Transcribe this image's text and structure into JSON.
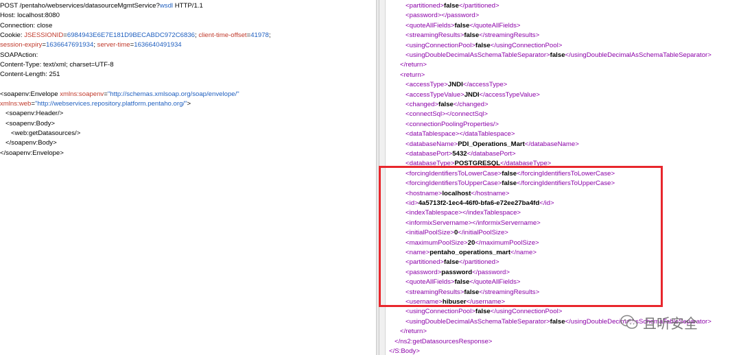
{
  "left": {
    "request_line": {
      "method_path": "POST /pentaho/webservices/datasourceMgmtService?",
      "param": "wsdl",
      "proto": " HTTP/1.1"
    },
    "headers": [
      {
        "name": "Host",
        "value": "localhost:8080"
      },
      {
        "name": "Connection",
        "value": "close"
      },
      {
        "name": "Cookie",
        "value": ""
      },
      {
        "name": "SOAPAction",
        "value": ""
      },
      {
        "name": "Content-Type",
        "value": "text/xml; charset=UTF-8"
      },
      {
        "name": "Content-Length",
        "value": "251"
      }
    ],
    "cookie_parts": [
      {
        "k": "JSESSIONID",
        "v": "6984943E6E7E181D9BECABDC972C6836"
      },
      {
        "k": "client-time-offset",
        "v": "41978"
      },
      {
        "k": "session-expiry",
        "v": "1636647691934"
      },
      {
        "k": "server-time",
        "v": "1636640491934"
      }
    ],
    "envelope_open": "<soapenv:Envelope",
    "ns_attr": "xmlns:soapenv",
    "ns_value": "\"http://schemas.xmlsoap.org/soap/envelope/\"",
    "ns2_attr": "xmlns:web",
    "ns2_value": "\"http://webservices.repository.platform.pentaho.org/\"",
    "header_tag": "<soapenv:Header/>",
    "body_open": "<soapenv:Body>",
    "web_tag": "<web:getDatasources/>",
    "body_close": "</soapenv:Body>",
    "envelope_close": "</soapenv:Envelope>"
  },
  "right": {
    "lines": [
      {
        "indent": 3,
        "tag": "partitioned",
        "value": "false"
      },
      {
        "indent": 3,
        "tag": "password",
        "value": ""
      },
      {
        "indent": 3,
        "tag": "quoteAllFields",
        "value": "false"
      },
      {
        "indent": 3,
        "tag": "streamingResults",
        "value": "false"
      },
      {
        "indent": 3,
        "tag": "usingConnectionPool",
        "value": "false"
      },
      {
        "indent": 3,
        "tag": "usingDoubleDecimalAsSchemaTableSeparator",
        "value": "false"
      },
      {
        "indent": 2,
        "raw": "</return>"
      },
      {
        "indent": 2,
        "raw": "<return>"
      },
      {
        "indent": 3,
        "tag": "accessType",
        "value": "JNDI"
      },
      {
        "indent": 3,
        "tag": "accessTypeValue",
        "value": "JNDI"
      },
      {
        "indent": 3,
        "tag": "changed",
        "value": "false"
      },
      {
        "indent": 3,
        "tag": "connectSql",
        "value": ""
      },
      {
        "indent": 3,
        "raw": "<connectionPoolingProperties/>"
      },
      {
        "indent": 3,
        "tag": "dataTablespace",
        "value": ""
      },
      {
        "indent": 3,
        "tag": "databaseName",
        "value": "PDI_Operations_Mart"
      },
      {
        "indent": 3,
        "tag": "databasePort",
        "value": "5432"
      },
      {
        "indent": 3,
        "tag": "databaseType",
        "value": "POSTGRESQL"
      },
      {
        "indent": 3,
        "tag": "forcingIdentifiersToLowerCase",
        "value": "false"
      },
      {
        "indent": 3,
        "tag": "forcingIdentifiersToUpperCase",
        "value": "false"
      },
      {
        "indent": 3,
        "tag": "hostname",
        "value": "localhost"
      },
      {
        "indent": 3,
        "tag": "id",
        "value": "4a5713f2-1ec4-46f0-bfa6-e72ee27ba4fd"
      },
      {
        "indent": 3,
        "tag": "indexTablespace",
        "value": ""
      },
      {
        "indent": 3,
        "tag": "informixServername",
        "value": ""
      },
      {
        "indent": 3,
        "tag": "initialPoolSize",
        "value": "0"
      },
      {
        "indent": 3,
        "tag": "maximumPoolSize",
        "value": "20"
      },
      {
        "indent": 3,
        "tag": "name",
        "value": "pentaho_operations_mart"
      },
      {
        "indent": 3,
        "tag": "partitioned",
        "value": "false"
      },
      {
        "indent": 3,
        "tag": "password",
        "value": "password"
      },
      {
        "indent": 3,
        "tag": "quoteAllFields",
        "value": "false"
      },
      {
        "indent": 3,
        "tag": "streamingResults",
        "value": "false"
      },
      {
        "indent": 3,
        "tag": "username",
        "value": "hibuser"
      },
      {
        "indent": 3,
        "tag": "usingConnectionPool",
        "value": "false"
      },
      {
        "indent": 3,
        "tag": "usingDoubleDecimalAsSchemaTableSeparator",
        "value": "false"
      },
      {
        "indent": 2,
        "raw": "</return>"
      },
      {
        "indent": 1,
        "raw": "</ns2:getDatasourcesResponse>"
      },
      {
        "indent": 0,
        "raw": "</S:Body>"
      }
    ]
  },
  "watermark": {
    "text": "且听安全",
    "icon": "wechat-icon"
  },
  "colors": {
    "highlight": "#e8262c",
    "tag": "#8b00a8",
    "header_name": "#c0392b",
    "header_value": "#1f5fbf"
  }
}
